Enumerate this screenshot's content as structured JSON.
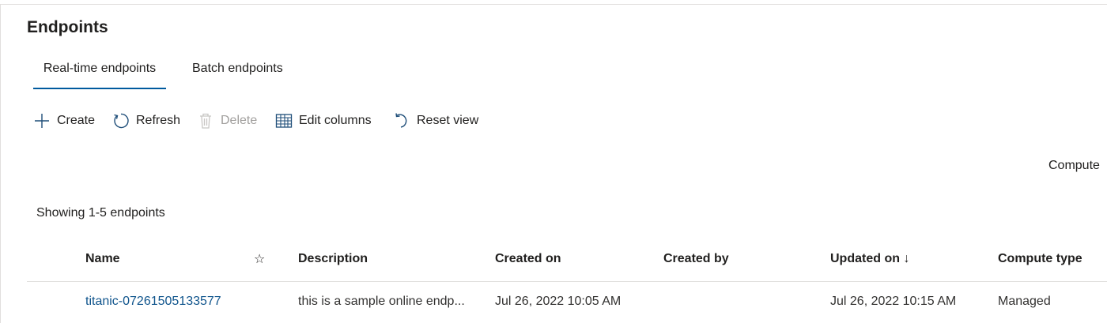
{
  "page": {
    "title": "Endpoints"
  },
  "tabs": [
    {
      "label": "Real-time endpoints",
      "selected": true
    },
    {
      "label": "Batch endpoints",
      "selected": false
    }
  ],
  "toolbar": {
    "create_label": "Create",
    "refresh_label": "Refresh",
    "delete_label": "Delete",
    "edit_columns_label": "Edit columns",
    "reset_view_label": "Reset view"
  },
  "filter": {
    "compute_label": "Compute"
  },
  "summary": {
    "showing_text": "Showing 1-5 endpoints"
  },
  "table": {
    "columns": {
      "name": "Name",
      "favorite": "☆",
      "description": "Description",
      "created_on": "Created on",
      "created_by": "Created by",
      "updated_on": "Updated on ↓",
      "compute_type": "Compute type"
    },
    "rows": [
      {
        "name": "titanic-07261505133577",
        "description": "this is a sample online endp...",
        "created_on": "Jul 26, 2022 10:05 AM",
        "created_by": "",
        "updated_on": "Jul 26, 2022 10:15 AM",
        "compute_type": "Managed"
      }
    ]
  },
  "colors": {
    "accent": "#005a9e",
    "link": "#0f548c",
    "disabled": "#a19f9d",
    "icon": "#1f4e79"
  },
  "icons": {
    "create": "plus-icon",
    "refresh": "refresh-icon",
    "delete": "trash-icon",
    "edit_columns": "table-grid-icon",
    "reset_view": "undo-icon",
    "favorite": "star-outline-icon",
    "sort": "arrow-down-icon"
  }
}
